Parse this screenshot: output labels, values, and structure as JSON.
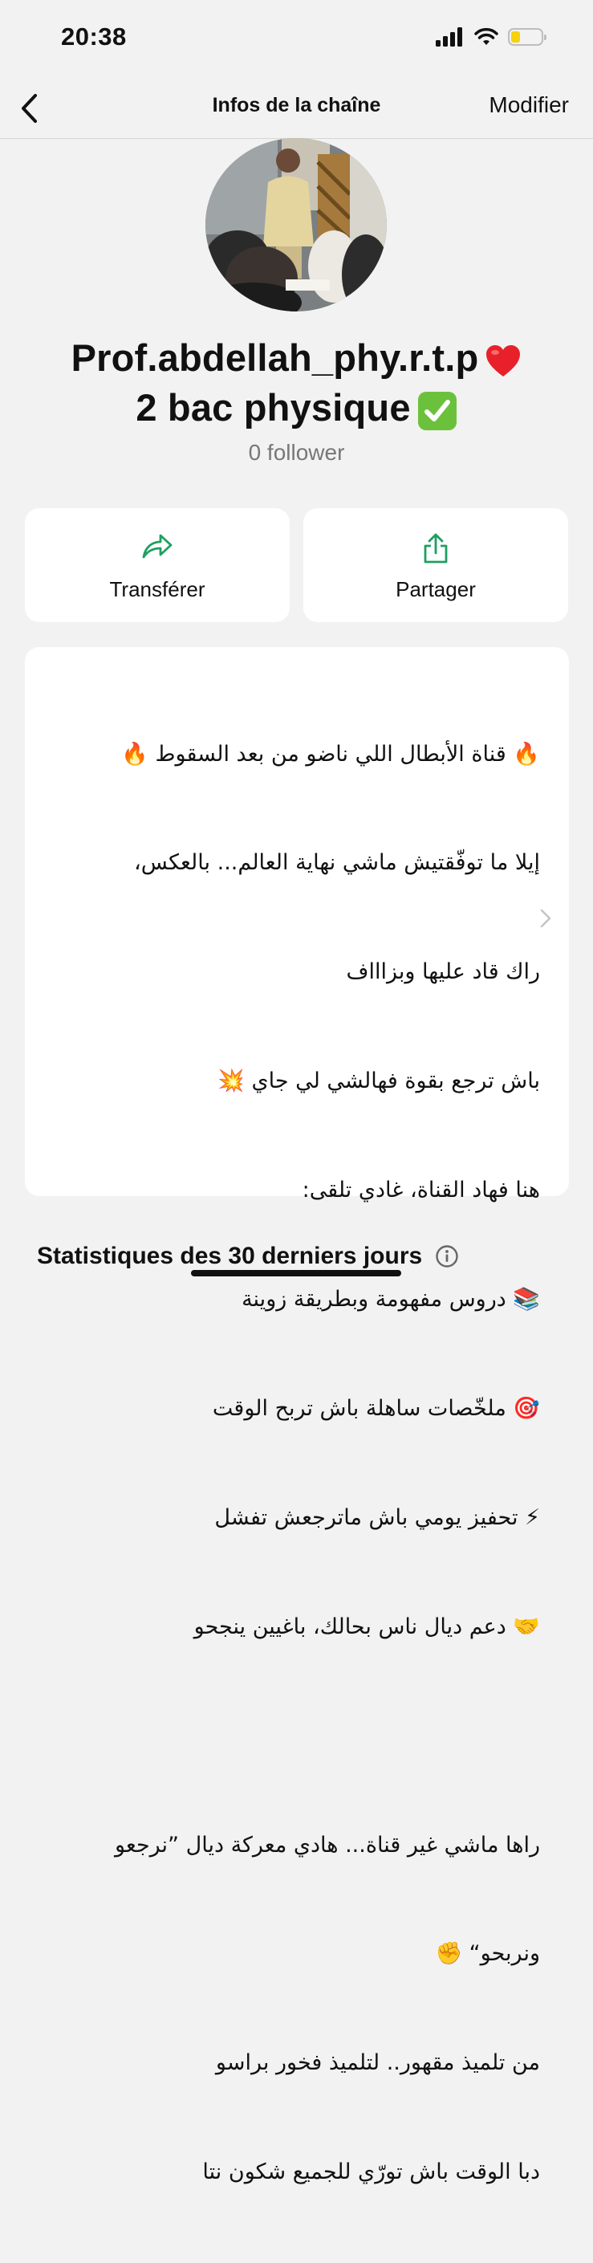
{
  "status_bar": {
    "time": "20:38",
    "icons": [
      "cellular-signal-icon",
      "wifi-icon",
      "battery-icon"
    ],
    "battery_level": 0.3,
    "battery_color": "#f5d20c"
  },
  "nav": {
    "title": "Infos de la chaîne",
    "action": "Modifier",
    "back_icon": "chevron-left-icon"
  },
  "channel": {
    "name_line1": "Prof.abdellah_phy.r.t.p",
    "name_line1_emoji": "heart-icon",
    "name_line2": "2 bac physique",
    "name_line2_emoji": "check-mark-button-icon",
    "followers": "0 follower"
  },
  "actions": {
    "transfer": {
      "label": "Transférer",
      "icon": "forward-arrow-icon"
    },
    "share": {
      "label": "Partager",
      "icon": "share-icon"
    }
  },
  "description": {
    "lines": [
      "🔥 قناة الأبطال اللي ناضو من بعد السقوط 🔥",
      "إيلا ما توفّقتيش ماشي نهاية العالم... بالعكس،",
      "راك قاد عليها وبزاااف",
      "باش ترجع بقوة فهالشي لي جاي 💥",
      "هنا فهاد القناة، غادي تلقى:",
      "📚 دروس مفهومة وبطريقة زوينة",
      "🎯 ملخّصات ساهلة باش تربح الوقت",
      "⚡ تحفيز يومي باش ماترجعش تفشل",
      "🤝 دعم ديال ناس بحالك، باغيين ينجحو",
      "",
      "راها ماشي غير قناة... هادي معركة ديال ”نرجعو",
      "ونربحو“ ✊",
      "من تلميذ مقهور.. لتلميذ فخور براسو",
      "دبا الوقت باش تورّي للجميع شكون نتا"
    ],
    "chevron_icon": "chevron-right-icon"
  },
  "stats": {
    "title": "Statistiques des 30 derniers jours",
    "info_icon": "info-circle-icon"
  },
  "colors": {
    "accent_green": "#1e9f61",
    "background": "#f2f2f2",
    "card": "#ffffff",
    "muted_text": "#777777"
  }
}
